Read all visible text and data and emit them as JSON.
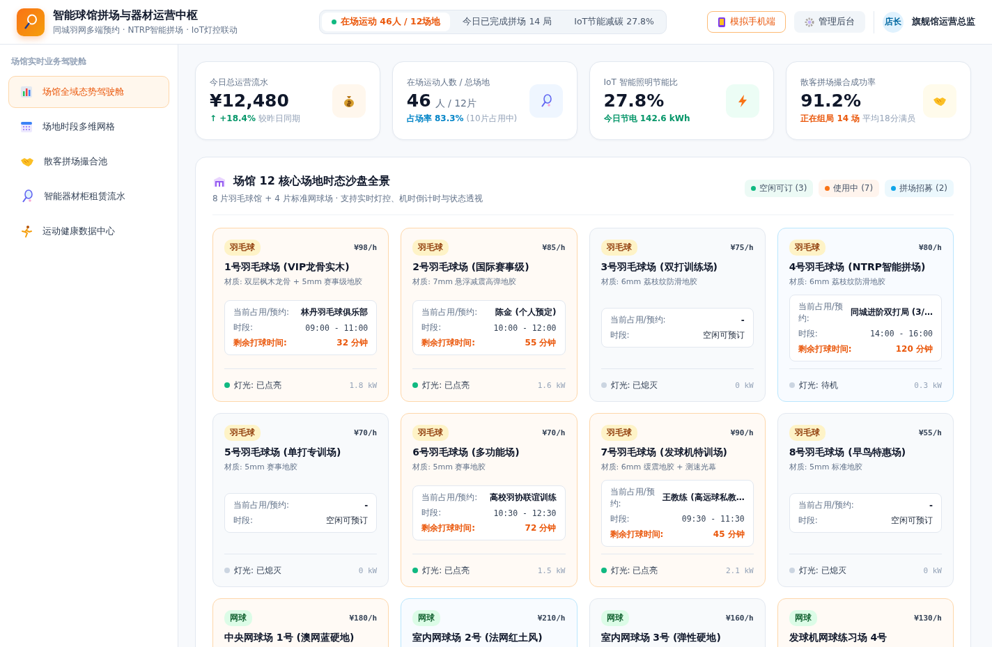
{
  "app": {
    "title": "智能球馆拼场与器材运营中枢",
    "subtitle": "同城羽网多端预约 · NTRP智能拼场 · IoT灯控联动"
  },
  "header_stats": [
    {
      "label": "在场运动 46人 / 12场地",
      "selected": true
    },
    {
      "label": "今日已完成拼场 14 局",
      "selected": false
    },
    {
      "label": "IoT节能减碳 27.8%",
      "selected": false
    }
  ],
  "header_buttons": [
    {
      "label": "模拟手机端",
      "kind": "phone"
    },
    {
      "label": "管理后台",
      "kind": "gear"
    }
  ],
  "user": {
    "avatar": "店长",
    "name": "旗舰馆运营总监"
  },
  "sidebar": {
    "heading": "场馆实时业务驾驶舱",
    "items": [
      {
        "label": "场馆全域态势驾驶舱",
        "kind": "chart",
        "selected": true
      },
      {
        "label": "场地时段多维网格",
        "kind": "calendar",
        "selected": false
      },
      {
        "label": "散客拼场撮合池",
        "kind": "handshake",
        "selected": false
      },
      {
        "label": "智能器材柜租赁流水",
        "kind": "racket",
        "selected": false
      },
      {
        "label": "运动健康数据中心",
        "kind": "runner",
        "selected": false
      }
    ]
  },
  "kpis": [
    {
      "label": "今日总运营流水",
      "value": "¥12,480",
      "note_strong": "↑ +18.4%",
      "note": "较昨日同期",
      "kind": "money"
    },
    {
      "label": "在场运动人数 / 总场地",
      "value": "46",
      "unit": "人 / 12片",
      "note_strong": "占场率 83.3%",
      "note": "(10片占用中)",
      "kind": "racket"
    },
    {
      "label": "IoT 智能照明节能比",
      "value": "27.8%",
      "note_strong": "今日节电 142.6 kWh",
      "kind": "bolt"
    },
    {
      "label": "散客拼场撮合成功率",
      "value": "91.2%",
      "note_strong": "正在组局 14 场",
      "note": "平均18分满员",
      "kind": "handshake"
    }
  ],
  "court_panel": {
    "title": "场馆 12 核心场地时态沙盘全景",
    "subtitle": "8 片羽毛球馆 + 4 片标准网球场 · 支持实时灯控、机时倒计时与状态透视",
    "legend": [
      {
        "label": "空闲可订 (3)",
        "color": "#10b981"
      },
      {
        "label": "使用中 (7)",
        "color": "#f97316"
      },
      {
        "label": "拼场招募 (2)",
        "color": "#0ea5e9"
      }
    ],
    "courts": [
      {
        "kind": "badminton",
        "sport_label": "羽毛球",
        "price": "¥98/h",
        "name": "1号羽毛球场 (VIP龙骨实木)",
        "material": "材质: 双层枫木龙骨 + 5mm 赛事级地胶",
        "color": "#fed7aa",
        "booking": {
          "label": "当前占用/预约:",
          "value": "林丹羽毛球俱乐部",
          "time_label": "时段:",
          "time": "09:00 - 11:00",
          "remain_label": "剩余打球时间:",
          "remain": "32 分钟"
        },
        "light": "灯光: 已点亮",
        "light_on": true,
        "power": "1.8 kW"
      },
      {
        "kind": "badminton",
        "sport_label": "羽毛球",
        "price": "¥85/h",
        "name": "2号羽毛球场 (国际赛事级)",
        "material": "材质: 7mm 悬浮减震高弹地胶",
        "color": "#fed7aa",
        "booking": {
          "label": "当前占用/预约:",
          "value": "陈金 (个人预定)",
          "time_label": "时段:",
          "time": "10:00 - 12:00",
          "remain_label": "剩余打球时间:",
          "remain": "55 分钟"
        },
        "light": "灯光: 已点亮",
        "light_on": true,
        "power": "1.6 kW"
      },
      {
        "kind": "badminton",
        "sport_label": "羽毛球",
        "price": "¥75/h",
        "name": "3号羽毛球场 (双打训练场)",
        "material": "材质: 6mm 荔枝纹防滑地胶",
        "color": "#e2e8f0",
        "booking": {
          "label": "当前占用/预约:",
          "value": "-",
          "time_label": "时段:",
          "time": "空闲可预订"
        },
        "light": "灯光: 已熄灭",
        "light_on": false,
        "power": "0 kW"
      },
      {
        "kind": "badminton",
        "sport_label": "羽毛球",
        "price": "¥80/h",
        "name": "4号羽毛球场 (NTRP智能拼场)",
        "material": "材质: 6mm 荔枝纹防滑地胶",
        "color": "#bae6fd",
        "booking": {
          "label": "当前占用/预约:",
          "value": "同城进阶双打局 (3/…",
          "time_label": "时段:",
          "time": "14:00 - 16:00",
          "remain_label": "剩余打球时间:",
          "remain": "120 分钟"
        },
        "light": "灯光: 待机",
        "light_on": false,
        "power": "0.3 kW"
      },
      {
        "kind": "badminton",
        "sport_label": "羽毛球",
        "price": "¥70/h",
        "name": "5号羽毛球场 (单打专训场)",
        "material": "材质: 5mm 赛事地胶",
        "color": "#e2e8f0",
        "booking": {
          "label": "当前占用/预约:",
          "value": "-",
          "time_label": "时段:",
          "time": "空闲可预订"
        },
        "light": "灯光: 已熄灭",
        "light_on": false,
        "power": "0 kW"
      },
      {
        "kind": "badminton",
        "sport_label": "羽毛球",
        "price": "¥70/h",
        "name": "6号羽毛球场 (多功能场)",
        "material": "材质: 5mm 赛事地胶",
        "color": "#fed7aa",
        "booking": {
          "label": "当前占用/预约:",
          "value": "高校羽协联谊训练",
          "time_label": "时段:",
          "time": "10:30 - 12:30",
          "remain_label": "剩余打球时间:",
          "remain": "72 分钟"
        },
        "light": "灯光: 已点亮",
        "light_on": true,
        "power": "1.5 kW"
      },
      {
        "kind": "badminton",
        "sport_label": "羽毛球",
        "price": "¥90/h",
        "name": "7号羽毛球场 (发球机特训场)",
        "material": "材质: 6mm 缓震地胶 + 测速光幕",
        "color": "#fed7aa",
        "booking": {
          "label": "当前占用/预约:",
          "value": "王教练 (高远球私教…",
          "time_label": "时段:",
          "time": "09:30 - 11:30",
          "remain_label": "剩余打球时间:",
          "remain": "45 分钟"
        },
        "light": "灯光: 已点亮",
        "light_on": true,
        "power": "2.1 kW"
      },
      {
        "kind": "badminton",
        "sport_label": "羽毛球",
        "price": "¥55/h",
        "name": "8号羽毛球场 (早鸟特惠场)",
        "material": "材质: 5mm 标准地胶",
        "color": "#e2e8f0",
        "booking": {
          "label": "当前占用/预约:",
          "value": "-",
          "time_label": "时段:",
          "time": "空闲可预订"
        },
        "light": "灯光: 已熄灭",
        "light_on": false,
        "power": "0 kW"
      },
      {
        "kind": "tennis",
        "sport_label": "网球",
        "price": "¥180/h",
        "name": "中央网球场 1号 (澳网蓝硬地)",
        "color": "#fed7aa"
      },
      {
        "kind": "tennis",
        "sport_label": "网球",
        "price": "¥210/h",
        "name": "室内网球场 2号 (法网红土风)",
        "color": "#bae6fd"
      },
      {
        "kind": "tennis",
        "sport_label": "网球",
        "price": "¥160/h",
        "name": "室内网球场 3号 (弹性硬地)",
        "color": "#e2e8f0"
      },
      {
        "kind": "tennis",
        "sport_label": "网球",
        "price": "¥130/h",
        "name": "发球机网球练习场 4号",
        "color": "#fed7aa"
      }
    ]
  }
}
